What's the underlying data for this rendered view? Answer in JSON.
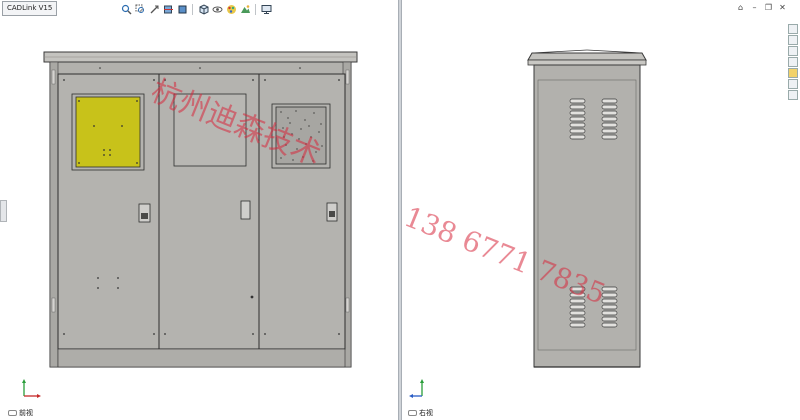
{
  "left_view": {
    "tab_label": "CADLink V15",
    "view_label": "前视"
  },
  "right_view": {
    "view_label": "右视"
  },
  "toolbar": {
    "icons": [
      "zoom-fit-icon",
      "zoom-area-icon",
      "zoom-in-out-icon",
      "section-view-icon",
      "display-style-icon",
      "view-orientation-icon",
      "hide-show-icon",
      "appearance-icon",
      "scene-icon",
      "monitor-icon"
    ]
  },
  "watermark": {
    "text_a": "杭州迪森技术",
    "text_b": "138 6771 7835"
  },
  "colors": {
    "cabinet_body": "#b2b1ad",
    "cabinet_edge": "#3a3a3a",
    "window_yellow": "#c8c21a",
    "window_gray": "#b8b7b3",
    "window_grain": "#9d9c99",
    "watermark": "#d7283c"
  }
}
